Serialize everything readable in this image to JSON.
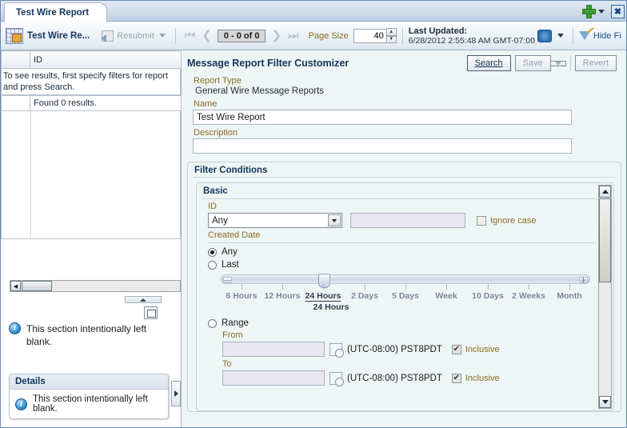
{
  "window": {
    "tab_label": "Test Wire Report",
    "add_icon": "plus-icon",
    "add_menu_icon": "chevron-down-icon",
    "close_icon": "close-icon"
  },
  "toolbar": {
    "report_icon": "report-table-icon",
    "title": "Test Wire Re...",
    "resubmit_label": "Resubmit",
    "resubmit_icon": "resubmit-icon",
    "resubmit_caret": "chevron-down-icon",
    "nav": {
      "first_icon": "first-page-icon",
      "prev_icon": "previous-page-icon",
      "range": "0 - 0 of 0",
      "next_icon": "next-page-icon",
      "last_icon": "last-page-icon"
    },
    "page_size_label": "Page Size",
    "page_size_value": "40",
    "spin_up": "▲",
    "spin_down": "▼",
    "last_updated_label": "Last Updated:",
    "last_updated_value": "6/28/2012 2:55:48 AM GMT-07:00",
    "refresh_icon": "refresh-icon",
    "refresh_caret": "chevron-down-icon",
    "hide_filter_label": "Hide Fi",
    "hide_filter_icon": "filter-edit-icon"
  },
  "results_panel": {
    "columns": [
      "",
      "ID"
    ],
    "empty_message": "To see results, first specify filters for report and press Search.",
    "found_message": "Found 0 results.",
    "hscroll_left_icon": "scroll-left-icon",
    "hscroll_right_icon": "scroll-right-icon",
    "collapse_icon": "collapse-up-icon",
    "detach_icon": "detach-icon",
    "blank_notice": "This section intentionally left blank.",
    "info_icon": "info-icon",
    "details": {
      "title": "Details",
      "message": "This section intentionally left blank.",
      "info_icon": "info-icon",
      "expand_icon": "expand-right-icon"
    }
  },
  "customizer": {
    "title": "Message Report Filter Customizer",
    "buttons": {
      "search": "Search",
      "save": "Save",
      "save_menu_icon": "chevron-down-icon",
      "revert": "Revert"
    },
    "report_type_label": "Report Type",
    "report_type_value": "General Wire Message Reports",
    "name_label": "Name",
    "name_value": "Test Wire Report",
    "description_label": "Description",
    "description_value": "",
    "filter_conditions_title": "Filter Conditions",
    "basic": {
      "title": "Basic",
      "id_label": "ID",
      "id_operator": "Any",
      "id_operator_icon": "chevron-down-icon",
      "id_value": "",
      "ignore_case_label": "Ignore case",
      "ignore_case_checked": false,
      "created_date_label": "Created Date",
      "any_label": "Any",
      "any_selected": true,
      "last_label": "Last",
      "last_selected": false,
      "slider": {
        "ticks": [
          "6 Hours",
          "12 Hours",
          "24 Hours",
          "2 Days",
          "5 Days",
          "Week",
          "10 Days",
          "2 Weeks",
          "Month"
        ],
        "current": "24 Hours",
        "current_index": 2,
        "minus_icon": "minus-icon",
        "plus_icon": "plus-icon"
      },
      "range_label": "Range",
      "range_selected": false,
      "from_label": "From",
      "from_value": "",
      "from_timezone": "(UTC-08:00) PST8PDT",
      "from_inclusive_label": "Inclusive",
      "from_inclusive_checked": true,
      "to_label": "To",
      "to_value": "",
      "to_timezone": "(UTC-08:00) PST8PDT",
      "to_inclusive_label": "Inclusive",
      "to_inclusive_checked": true,
      "calendar_icon": "calendar-picker-icon",
      "scroll_up_icon": "scroll-up-icon",
      "scroll_down_icon": "scroll-down-icon"
    }
  }
}
